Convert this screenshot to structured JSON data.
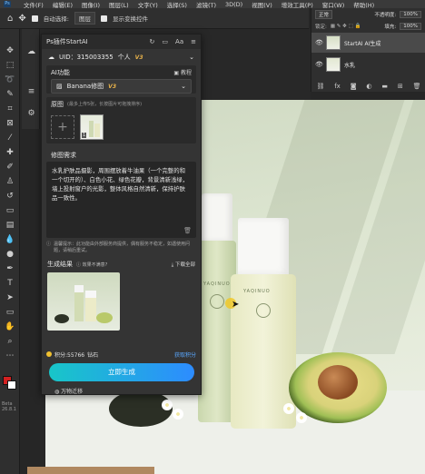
{
  "menubar": {
    "items": [
      "文件(F)",
      "编辑(E)",
      "图像(I)",
      "图层(L)",
      "文字(Y)",
      "选择(S)",
      "滤镜(T)",
      "3D(D)",
      "视图(V)",
      "增效工具(P)",
      "窗口(W)",
      "帮助(H)"
    ]
  },
  "options_bar": {
    "auto_select_label": "自动选择:",
    "auto_select_value": "图层",
    "show_transform_label": "显示变换控件"
  },
  "layers_panel": {
    "blend_mode": "正常",
    "opacity_label": "不透明度:",
    "opacity_value": "100%",
    "lock_label": "锁定:",
    "fill_label": "填充:",
    "fill_value": "100%",
    "layers": [
      {
        "name": "StartAI AI生成",
        "active": true
      },
      {
        "name": "水乳",
        "active": false
      }
    ],
    "footer_icons": [
      "link-icon",
      "fx-icon",
      "mask-icon",
      "adjustment-icon",
      "folder-icon",
      "new-layer-icon",
      "trash-icon"
    ]
  },
  "plugin": {
    "title": "Ps插件StartAI",
    "uid_label": "UID：315003355",
    "account_type": "个人",
    "account_badge": "V3",
    "ai_function_label": "AI功能",
    "tutorial_label": "教程",
    "model_name": "Banana修图",
    "model_badge": "V3",
    "source_image_label": "原图",
    "source_image_note": "(最多上传5张，长按图片可拖拽排序)",
    "ref_count": "1",
    "edit_request_label": "修图需求",
    "prompt_text": "水乳护肤品摄影，周围摆放着牛油果（一个完整的和一个切开的）、白色小花、绿色花瓣，背景清新浅绿，墙上投射窗户的光影，整体风格自然清新，保持护肤品一致性。",
    "tip_text": "温馨提示：此功能由外部服务商提供，偶有服务不稳定，如遇使用问题，请稍后重试。",
    "results_label": "生成结果",
    "satisfaction_label": "效果不满意?",
    "download_all_label": "下载全部",
    "points_label": "积分:55766",
    "coin_text": "钻石",
    "earn_points_label": "获取积分",
    "generate_button": "立即生成",
    "below_panel_text": "万物迁移"
  },
  "toolbar": {
    "beta_label": "Beta 26.8.1"
  },
  "canvas": {
    "brand_text": "YAQINUO"
  },
  "colors": {
    "foreground": "#d42020",
    "background": "#ffffff",
    "accent_gradient_start": "#18c6c8",
    "accent_gradient_end": "#2d8cff",
    "vip_gold": "#e8b24a"
  }
}
